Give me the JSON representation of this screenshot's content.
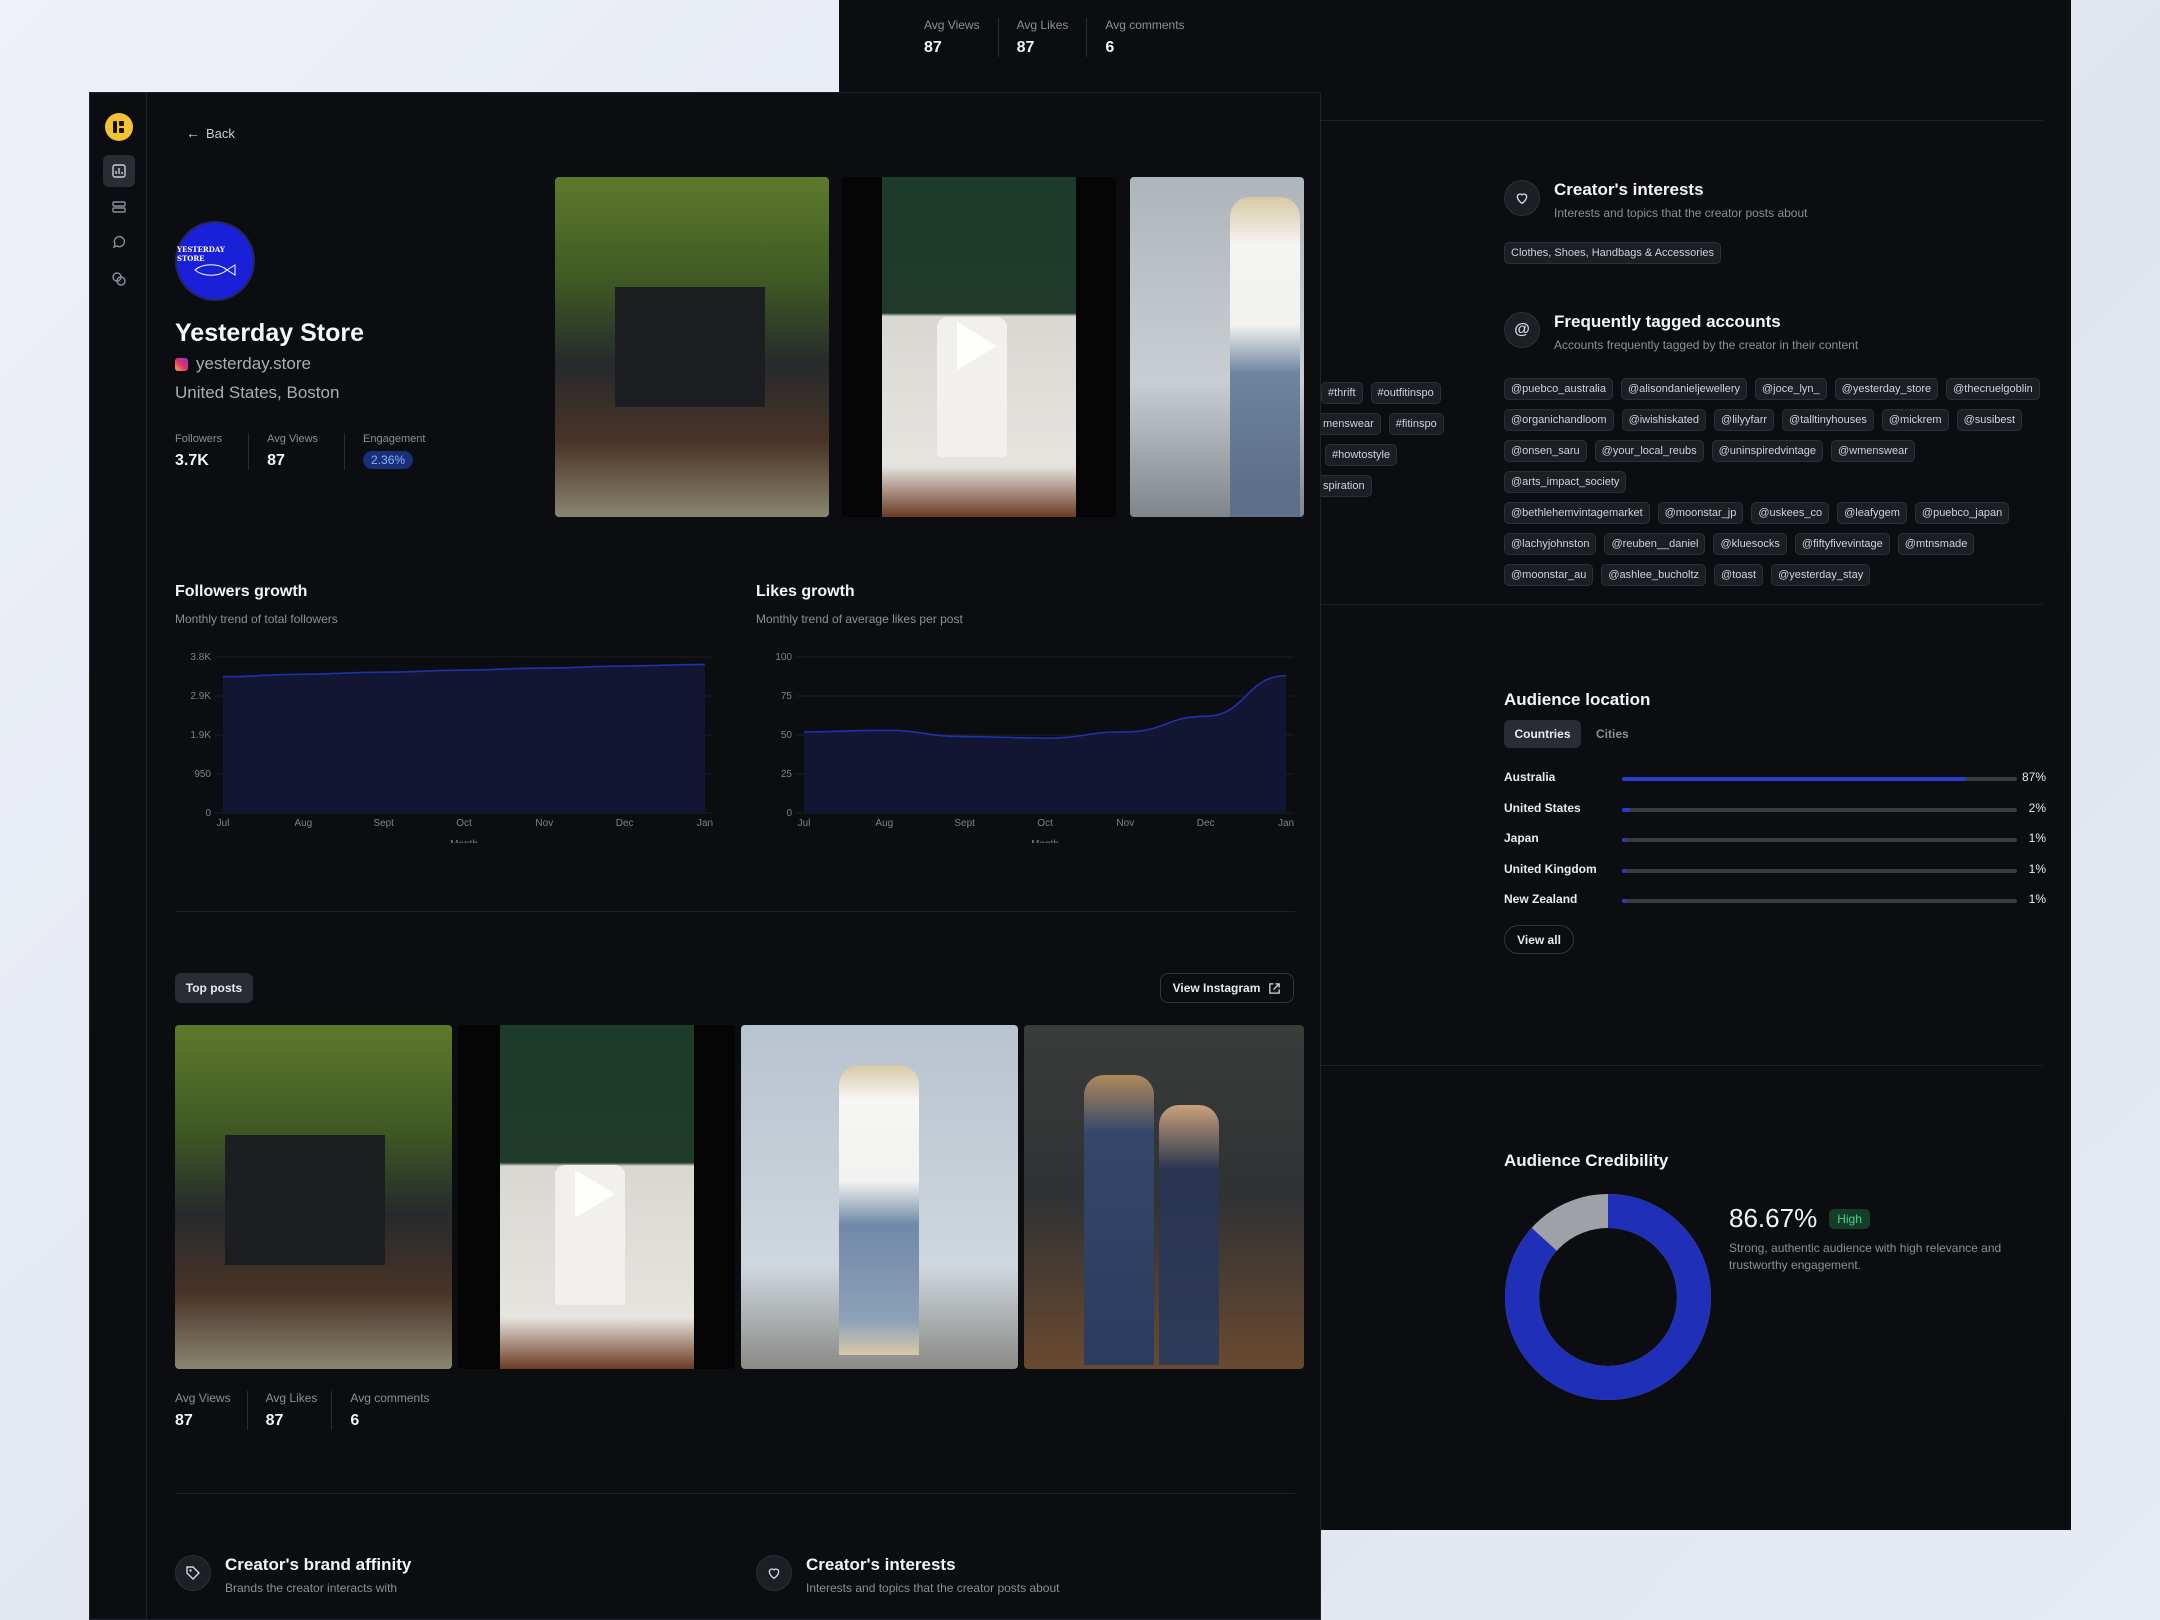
{
  "back_panel": {
    "top_stats": [
      {
        "label": "Avg Views",
        "value": "87"
      },
      {
        "label": "Avg Likes",
        "value": "87"
      },
      {
        "label": "Avg comments",
        "value": "6"
      }
    ],
    "interests": {
      "title": "Creator's interests",
      "subtitle": "Interests and topics that the creator posts about",
      "tags": [
        "Clothes, Shoes, Handbags & Accessories"
      ]
    },
    "tagged_accounts": {
      "title": "Frequently tagged accounts",
      "subtitle": "Accounts frequently tagged by the creator in their content",
      "rows": [
        [
          "@puebco_australia",
          "@alisondanieljewellery",
          "@joce_lyn_",
          "@yesterday_store",
          "@thecruelgoblin"
        ],
        [
          "@organichandloom",
          "@iwishiskated",
          "@lilyyfarr",
          "@talltinyhouses",
          "@mickrem",
          "@susibest"
        ],
        [
          "@onsen_saru",
          "@your_local_reubs",
          "@uninspiredvintage",
          "@wmenswear",
          "@arts_impact_society"
        ],
        [
          "@bethlehemvintagemarket",
          "@moonstar_jp",
          "@uskees_co",
          "@leafygem",
          "@puebco_japan"
        ],
        [
          "@lachyjohnston",
          "@reuben__daniel",
          "@kluesocks",
          "@fiftyfivevintage",
          "@mtnsmade"
        ],
        [
          "@moonstar_au",
          "@ashlee_bucholtz",
          "@toast",
          "@yesterday_stay"
        ]
      ]
    },
    "partial_hashtags": [
      [
        "#thrift",
        "#outfitinspo"
      ],
      [
        "menswear",
        "#fitinspo"
      ],
      [
        "#howtostyle"
      ],
      [
        "spiration"
      ]
    ],
    "audience_location": {
      "title": "Audience location",
      "tabs": [
        "Countries",
        "Cities"
      ],
      "rows": [
        {
          "name": "Australia",
          "pct": "87%",
          "fraction": 0.87
        },
        {
          "name": "United States",
          "pct": "2%",
          "fraction": 0.02
        },
        {
          "name": "Japan",
          "pct": "1%",
          "fraction": 0.01
        },
        {
          "name": "United Kingdom",
          "pct": "1%",
          "fraction": 0.01
        },
        {
          "name": "New Zealand",
          "pct": "1%",
          "fraction": 0.01
        }
      ],
      "view_all": "View all"
    },
    "credibility": {
      "title": "Audience Credibility",
      "value": "86.67%",
      "fraction": 0.8667,
      "badge": "High",
      "description": "Strong, authentic audience with high relevance and trustworthy engagement.",
      "colors": {
        "primary": "#1f2fb8",
        "rest": "#9ea1a8",
        "badge_bg": "#143d2a",
        "badge_fg": "#4ed18a"
      }
    }
  },
  "front_panel": {
    "back_label": "Back",
    "profile": {
      "avatar_text": "YESTERDAY STORE",
      "name": "Yesterday Store",
      "handle": "yesterday.store",
      "location": "United States, Boston",
      "stats": [
        {
          "label": "Followers",
          "value": "3.7K"
        },
        {
          "label": "Avg Views",
          "value": "87"
        },
        {
          "label": "Engagement",
          "value": "2.36%"
        }
      ]
    },
    "charts": {
      "followers": {
        "title": "Followers growth",
        "subtitle": "Monthly trend of total followers"
      },
      "likes": {
        "title": "Likes growth",
        "subtitle": "Monthly trend of average likes per post"
      }
    },
    "top_posts": {
      "label": "Top posts",
      "view_instagram": "View Instagram",
      "stats": [
        {
          "label": "Avg Views",
          "value": "87"
        },
        {
          "label": "Avg Likes",
          "value": "87"
        },
        {
          "label": "Avg comments",
          "value": "6"
        }
      ]
    },
    "brand_affinity": {
      "title": "Creator's brand affinity",
      "subtitle": "Brands the creator interacts with"
    },
    "interests": {
      "title": "Creator's interests",
      "subtitle": "Interests and topics that the creator posts about"
    }
  },
  "chart_data": [
    {
      "type": "area",
      "x": [
        "Jul",
        "Aug",
        "Sept",
        "Oct",
        "Nov",
        "Dec",
        "Jan"
      ],
      "xlabel": "Month",
      "yticks": [
        "0",
        "950",
        "1.9K",
        "2.9K",
        "3.8K"
      ],
      "ylim": [
        0,
        3800
      ],
      "series": [
        {
          "values": [
            3320,
            3380,
            3430,
            3480,
            3530,
            3580,
            3620
          ]
        }
      ],
      "color": "#2230b0"
    },
    {
      "type": "area",
      "x": [
        "Jul",
        "Aug",
        "Sept",
        "Oct",
        "Nov",
        "Dec",
        "Jan"
      ],
      "xlabel": "Month",
      "yticks": [
        "0",
        "25",
        "50",
        "75",
        "100"
      ],
      "ylim": [
        0,
        100
      ],
      "series": [
        {
          "values": [
            52,
            53,
            49,
            48,
            52,
            62,
            88
          ]
        }
      ],
      "color": "#2230b0"
    }
  ]
}
